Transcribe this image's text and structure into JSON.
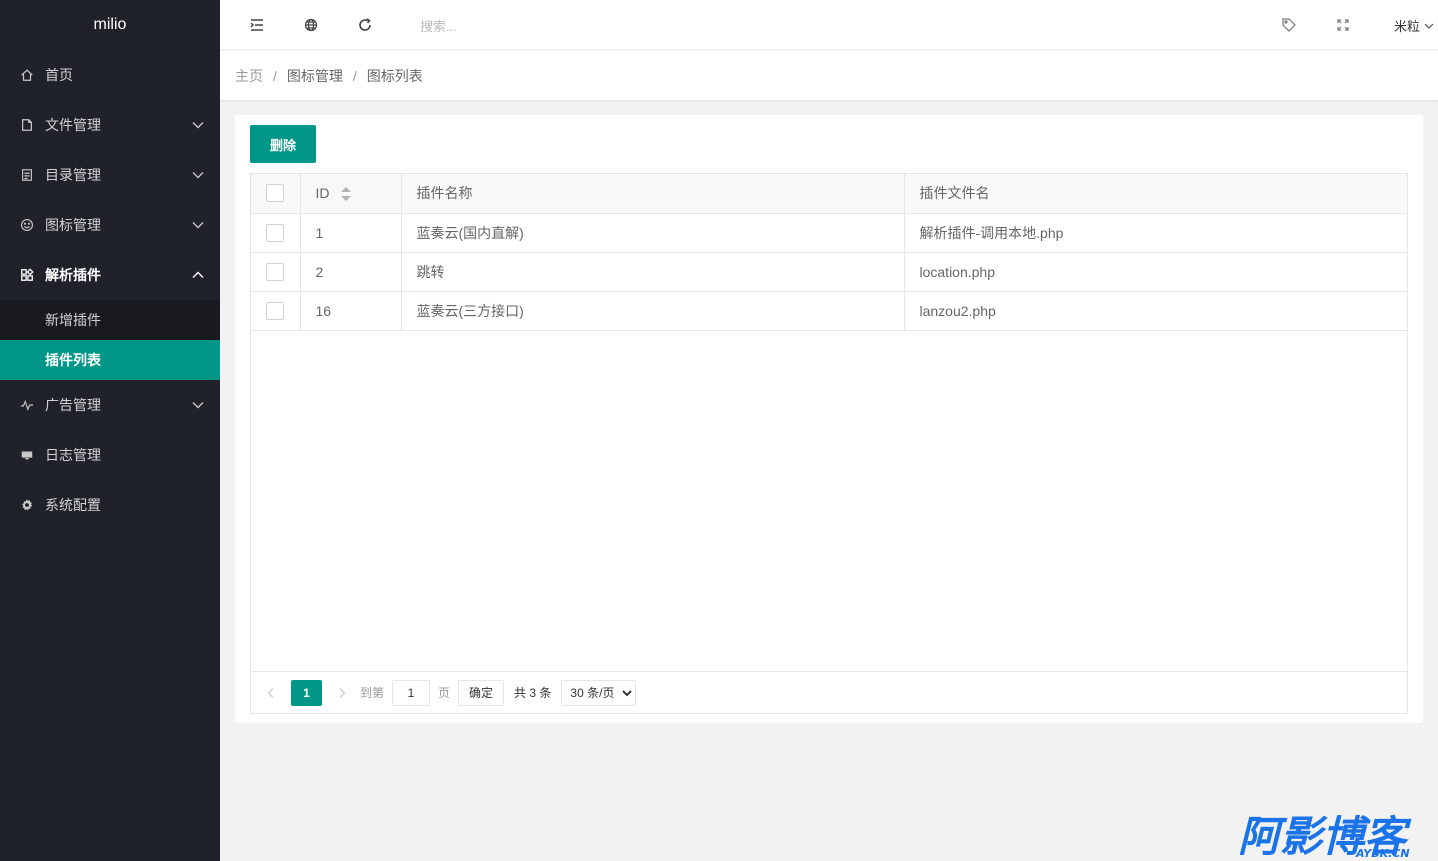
{
  "sidebar": {
    "logo": "milio",
    "items": [
      {
        "label": "首页",
        "icon": "home-icon"
      },
      {
        "label": "文件管理",
        "icon": "file-icon"
      },
      {
        "label": "目录管理",
        "icon": "list-icon"
      },
      {
        "label": "图标管理",
        "icon": "smile-icon"
      },
      {
        "label": "解析插件",
        "icon": "app-grid-icon"
      },
      {
        "label": "广告管理",
        "icon": "pulse-icon"
      },
      {
        "label": "日志管理",
        "icon": "monitor-icon"
      },
      {
        "label": "系统配置",
        "icon": "gear-icon"
      }
    ],
    "subitems": [
      {
        "label": "新增插件"
      },
      {
        "label": "插件列表"
      }
    ]
  },
  "header": {
    "search_placeholder": "搜索...",
    "user": "米粒"
  },
  "breadcrumb": {
    "home": "主页",
    "section": "图标管理",
    "current": "图标列表",
    "separator": "/"
  },
  "toolbar": {
    "delete_label": "删除"
  },
  "table": {
    "columns": [
      "ID",
      "插件名称",
      "插件文件名"
    ],
    "rows": [
      {
        "id": "1",
        "name": "蓝奏云(国内直解)",
        "file": "解析插件-调用本地.php"
      },
      {
        "id": "2",
        "name": "跳转",
        "file": "location.php"
      },
      {
        "id": "16",
        "name": "蓝奏云(三方接口)",
        "file": "lanzou2.php"
      }
    ]
  },
  "pagination": {
    "current_page": "1",
    "goto_label": "到第",
    "goto_value": "1",
    "page_label": "页",
    "confirm_label": "确定",
    "total_label": "共 3 条",
    "page_size": "30 条/页"
  },
  "watermark": {
    "text": "阿影博客",
    "sub": "AYBK.CN"
  },
  "colors": {
    "accent": "#009688",
    "sidebar_bg": "#20222a",
    "sidebar_sub_bg": "#181a20"
  }
}
